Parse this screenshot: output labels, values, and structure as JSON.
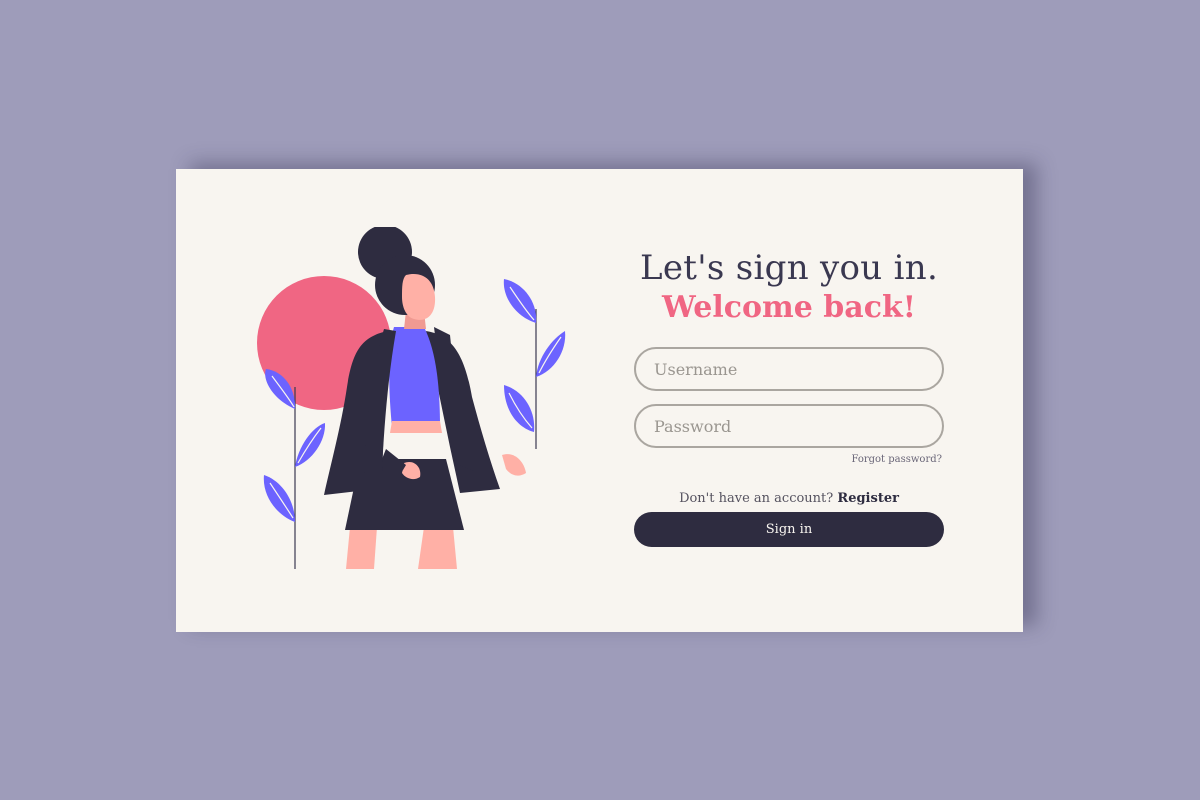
{
  "colors": {
    "background": "#9e9cba",
    "card": "#f8f5f0",
    "title": "#3a3850",
    "accent": "#f06683",
    "button": "#2e2c40",
    "leaf": "#6c63ff",
    "skin": "#ffb0a6"
  },
  "login": {
    "title": "Let's sign you in.",
    "subtitle": "Welcome back!",
    "username_placeholder": "Username",
    "password_placeholder": "Password",
    "forgot_label": "Forgot password?",
    "register_prompt": "Don't have an account?",
    "register_label": "Register",
    "signin_label": "Sign in"
  }
}
